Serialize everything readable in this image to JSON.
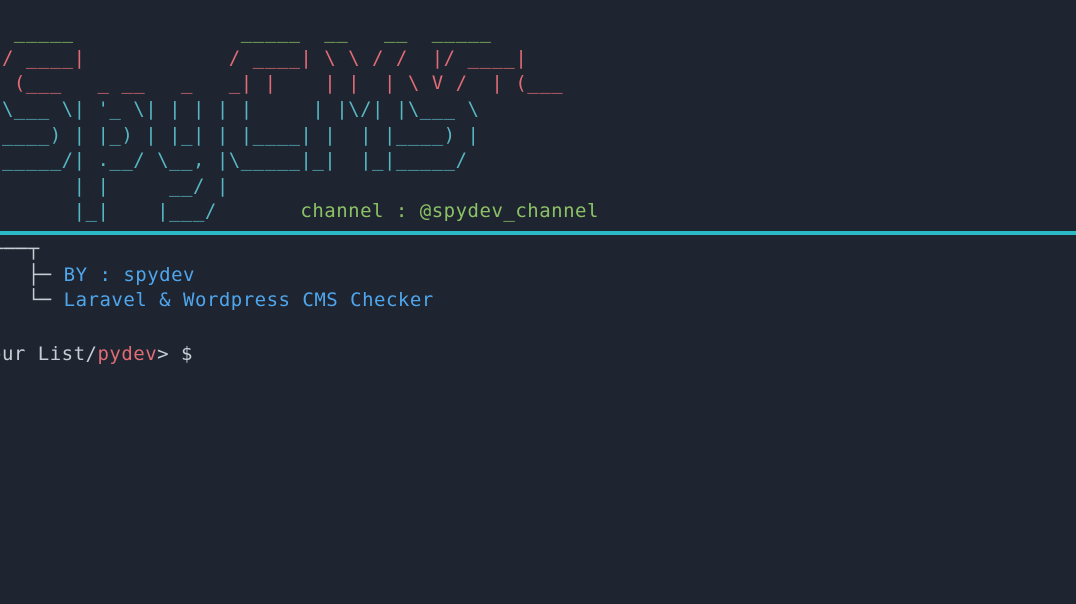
{
  "ascii": {
    "l1_a": "  _____              ",
    "l1_b": "_____  __   __  _____",
    "l2_a": " / ____|            ",
    "l2_b": "/ ____| \\ \\ / /  |/ ____|",
    "l3_a": "| (___   _ __   _   _",
    "l3_b": "| |    | |  | \\ V /  | (___",
    "l4": " \\___ \\| '_ \\| | | | |     | |\\/| |\\___ \\",
    "l5": " ____) | |_) | |_| | |____| |  | |____) |",
    "l6": "|_____/| .__/ \\__, |\\_____|_|  |_|_____/",
    "l7": "       | |     __/ |",
    "l8": "       |_|    |___/",
    "channel": "       channel : @spydev_channel"
  },
  "info": {
    "tree_top": "┬──┬",
    "tree_branch": "   ├─ ",
    "tree_last": "   └─ ",
    "author": "BY : spydev",
    "description": "Laravel & Wordpress CMS Checker"
  },
  "prompt": {
    "path": "our List/",
    "dir": "pydev",
    "symbol": "> $"
  }
}
